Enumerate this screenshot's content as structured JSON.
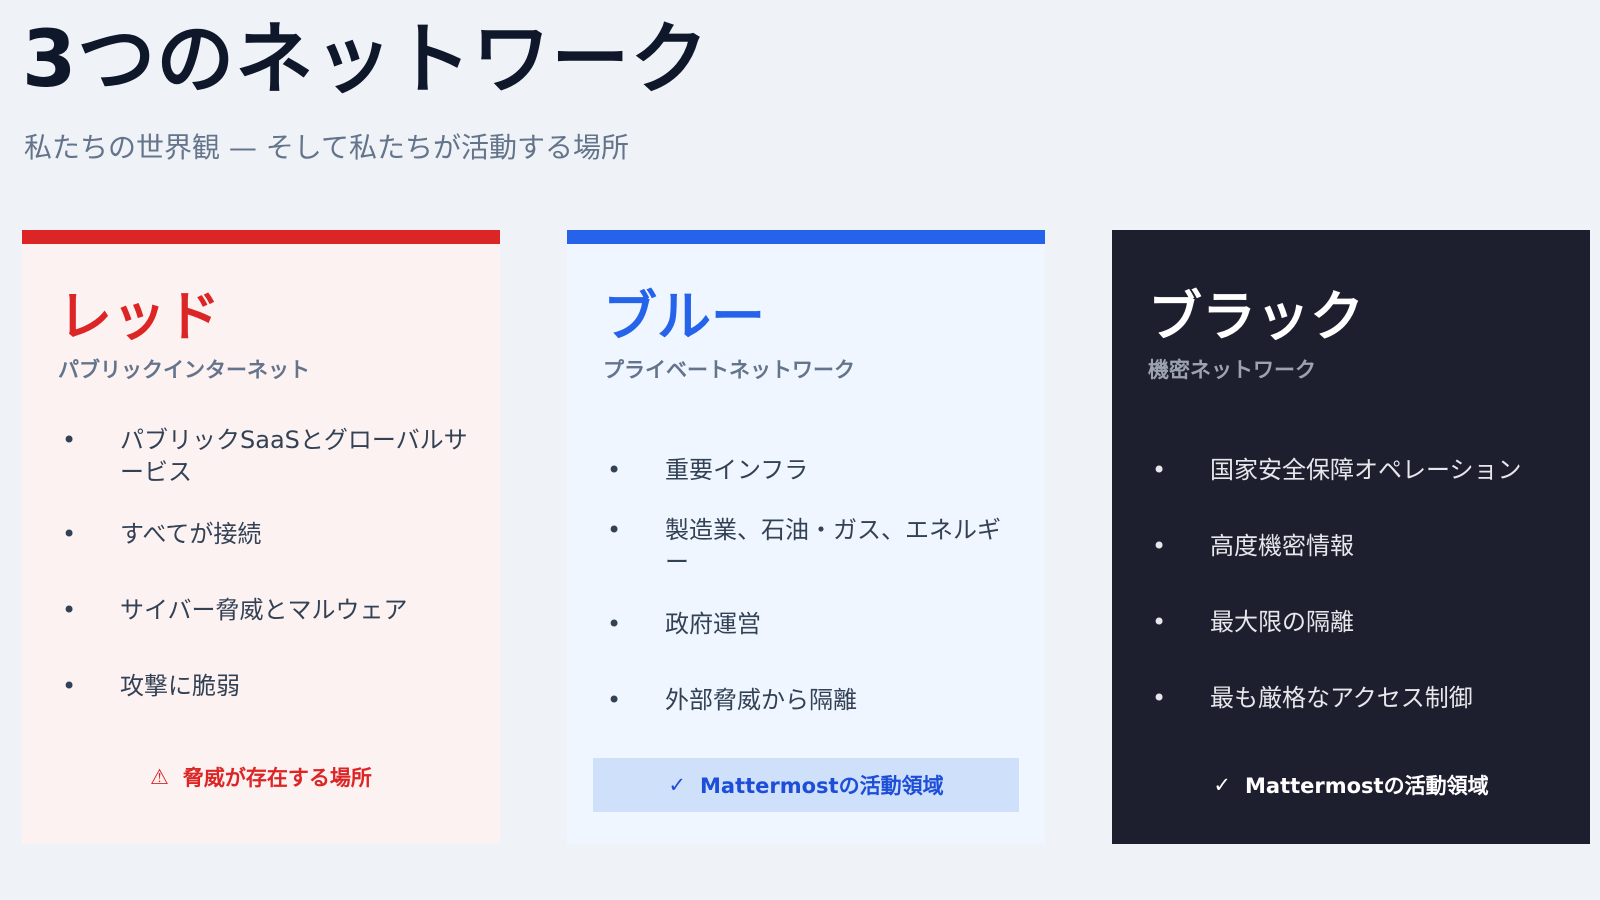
{
  "header": {
    "title": "3つのネットワーク",
    "subtitle": "私たちの世界観 — そして私たちが活動する場所"
  },
  "cards": [
    {
      "name": "レッド",
      "subtitle": "パブリックインターネット",
      "items": [
        "パブリックSaaSとグローバルサービス",
        "すべてが接続",
        "サイバー脅威とマルウェア",
        "攻撃に脆弱"
      ],
      "footer": {
        "icon": "warning-icon",
        "symbol": "⚠",
        "label": "脅威が存在する場所"
      },
      "accent": "#dc2626"
    },
    {
      "name": "ブルー",
      "subtitle": "プライベートネットワーク",
      "items": [
        "重要インフラ",
        "製造業、石油・ガス、エネルギー",
        "政府運営",
        "外部脅威から隔離"
      ],
      "footer": {
        "icon": "check-icon",
        "symbol": "✓",
        "label": "Mattermostの活動領域"
      },
      "accent": "#2563eb"
    },
    {
      "name": "ブラック",
      "subtitle": "機密ネットワーク",
      "items": [
        "国家安全保障オペレーション",
        "高度機密情報",
        "最大限の隔離",
        "最も厳格なアクセス制御"
      ],
      "footer": {
        "icon": "check-icon",
        "symbol": "✓",
        "label": "Mattermostの活動領域"
      },
      "accent": "#1e1f2e"
    }
  ],
  "bullet": "•"
}
